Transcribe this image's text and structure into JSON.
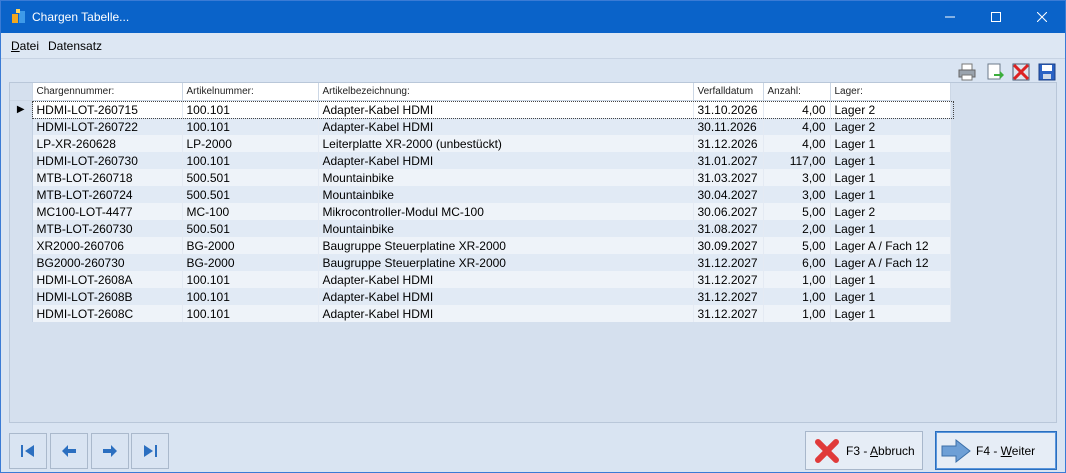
{
  "window": {
    "title": "Chargen Tabelle..."
  },
  "menu": {
    "items": [
      {
        "label": "Datei",
        "accel": "D",
        "rest": "atei"
      },
      {
        "label": "Datensatz"
      }
    ]
  },
  "toolbar": {
    "icons": [
      "print-icon",
      "export-icon",
      "delete-icon",
      "save-icon"
    ]
  },
  "grid": {
    "columns": [
      "Chargennummer:",
      "Artikelnummer:",
      "Artikelbezeichnung:",
      "Verfalldatum",
      "Anzahl:",
      "Lager:"
    ],
    "rows": [
      [
        "HDMI-LOT-260715",
        "100.101",
        "Adapter-Kabel HDMI",
        "31.10.2026",
        "4,00",
        "Lager 2"
      ],
      [
        "HDMI-LOT-260722",
        "100.101",
        "Adapter-Kabel HDMI",
        "30.11.2026",
        "4,00",
        "Lager 2"
      ],
      [
        "LP-XR-260628",
        "LP-2000",
        "Leiterplatte XR-2000 (unbestückt)",
        "31.12.2026",
        "4,00",
        "Lager 1"
      ],
      [
        "HDMI-LOT-260730",
        "100.101",
        "Adapter-Kabel HDMI",
        "31.01.2027",
        "117,00",
        "Lager 1"
      ],
      [
        "MTB-LOT-260718",
        "500.501",
        "Mountainbike",
        "31.03.2027",
        "3,00",
        "Lager 1"
      ],
      [
        "MTB-LOT-260724",
        "500.501",
        "Mountainbike",
        "30.04.2027",
        "3,00",
        "Lager 1"
      ],
      [
        "MC100-LOT-4477",
        "MC-100",
        "Mikrocontroller-Modul MC-100",
        "30.06.2027",
        "5,00",
        "Lager 2"
      ],
      [
        "MTB-LOT-260730",
        "500.501",
        "Mountainbike",
        "31.08.2027",
        "2,00",
        "Lager 1"
      ],
      [
        "XR2000-260706",
        "BG-2000",
        "Baugruppe Steuerplatine XR-2000",
        "30.09.2027",
        "5,00",
        "Lager A / Fach 12"
      ],
      [
        "BG2000-260730",
        "BG-2000",
        "Baugruppe Steuerplatine XR-2000",
        "31.12.2027",
        "6,00",
        "Lager A / Fach 12"
      ],
      [
        "HDMI-LOT-2608A",
        "100.101",
        "Adapter-Kabel HDMI",
        "31.12.2027",
        "1,00",
        "Lager 1"
      ],
      [
        "HDMI-LOT-2608B",
        "100.101",
        "Adapter-Kabel HDMI",
        "31.12.2027",
        "1,00",
        "Lager 1"
      ],
      [
        "HDMI-LOT-2608C",
        "100.101",
        "Adapter-Kabel HDMI",
        "31.12.2027",
        "1,00",
        "Lager 1"
      ]
    ],
    "selected_row": 0
  },
  "navigation": {
    "icons": [
      "first-record-icon",
      "previous-record-icon",
      "next-record-icon",
      "last-record-icon"
    ]
  },
  "actions": {
    "cancel": {
      "prefix": "F3 - ",
      "accel": "A",
      "rest": "bbruch"
    },
    "next": {
      "prefix": "F4 - ",
      "accel": "W",
      "rest": "eiter"
    }
  },
  "colors": {
    "titlebar": "#0a63c9",
    "accent": "#2a6fbf",
    "cancel_x": "#e03a3a"
  }
}
